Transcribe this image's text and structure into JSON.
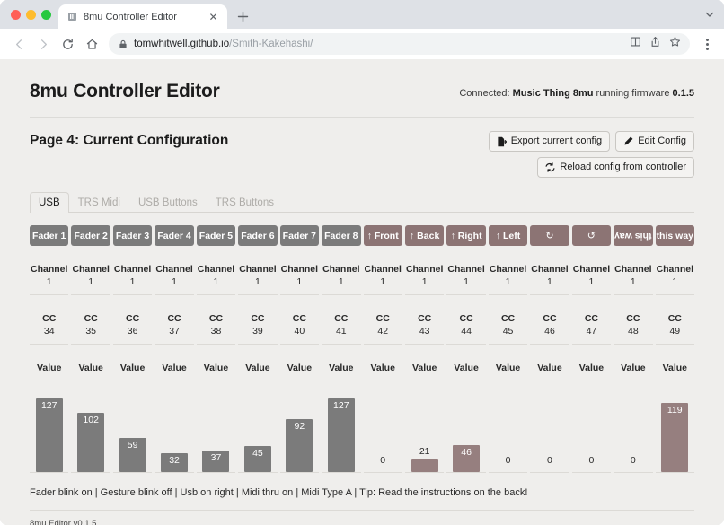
{
  "browser": {
    "tab": {
      "title": "8mu Controller Editor",
      "favicon_icon": "page-icon",
      "close_icon": "close-icon"
    },
    "new_tab_icon": "plus-icon",
    "tabstrip_menu_icon": "chevron-down-icon",
    "nav": {
      "back_icon": "arrow-left-icon",
      "forward_icon": "arrow-right-icon",
      "reload_icon": "reload-icon",
      "home_icon": "home-icon"
    },
    "omnibox": {
      "lock_icon": "lock-icon",
      "url_bold": "tomwhitwell.github.io",
      "url_rest": "/Smith-Kakehashi/",
      "reading_list_icon": "reading-list-icon",
      "share_icon": "share-icon",
      "bookmark_icon": "star-icon"
    },
    "menu_icon": "kebab-menu-icon"
  },
  "app": {
    "title": "8mu Controller Editor",
    "connection": {
      "prefix": "Connected:",
      "device": "Music Thing 8mu",
      "middle": "running firmware",
      "firmware": "0.1.5"
    },
    "page_title": "Page 4: Current Configuration",
    "buttons": {
      "export": {
        "label": "Export current config",
        "icon": "file-export-icon"
      },
      "edit": {
        "label": "Edit Config",
        "icon": "pencil-icon"
      },
      "reload": {
        "label": "Reload config from controller",
        "icon": "refresh-icon"
      }
    },
    "tabs": [
      {
        "label": "USB",
        "active": true
      },
      {
        "label": "TRS Midi",
        "active": false
      },
      {
        "label": "USB Buttons",
        "active": false
      },
      {
        "label": "TRS Buttons",
        "active": false
      }
    ],
    "row_labels": {
      "channel": "Channel",
      "cc": "CC",
      "value": "Value"
    },
    "footnote": "Fader blink on | Gesture blink off | Usb on right | Midi thru on | Midi Type A | Tip: Read the instructions on the back!",
    "version": "8mu Editor v0.1.5"
  },
  "chart_data": {
    "type": "bar",
    "title": "Page 4: Current Configuration",
    "xlabel": "",
    "ylabel": "Value",
    "ylim": [
      0,
      127
    ],
    "grid": false,
    "legend": "none",
    "categories": [
      "Fader 1",
      "Fader 2",
      "Fader 3",
      "Fader 4",
      "Fader 5",
      "Fader 6",
      "Fader 7",
      "Fader 8",
      "↑ Front",
      "↑ Back",
      "↑ Right",
      "↑ Left",
      "↻",
      "↺",
      "this way",
      "this way"
    ],
    "values": [
      127,
      102,
      59,
      32,
      37,
      45,
      92,
      127,
      0,
      21,
      46,
      0,
      0,
      0,
      0,
      119
    ],
    "columns": [
      {
        "label": "Fader 1",
        "kind": "fader",
        "rotated": false,
        "channel": "1",
        "cc": "34",
        "value": 127
      },
      {
        "label": "Fader 2",
        "kind": "fader",
        "rotated": false,
        "channel": "1",
        "cc": "35",
        "value": 102
      },
      {
        "label": "Fader 3",
        "kind": "fader",
        "rotated": false,
        "channel": "1",
        "cc": "36",
        "value": 59
      },
      {
        "label": "Fader 4",
        "kind": "fader",
        "rotated": false,
        "channel": "1",
        "cc": "37",
        "value": 32
      },
      {
        "label": "Fader 5",
        "kind": "fader",
        "rotated": false,
        "channel": "1",
        "cc": "38",
        "value": 37
      },
      {
        "label": "Fader 6",
        "kind": "fader",
        "rotated": false,
        "channel": "1",
        "cc": "39",
        "value": 45
      },
      {
        "label": "Fader 7",
        "kind": "fader",
        "rotated": false,
        "channel": "1",
        "cc": "40",
        "value": 92
      },
      {
        "label": "Fader 8",
        "kind": "fader",
        "rotated": false,
        "channel": "1",
        "cc": "41",
        "value": 127
      },
      {
        "label": "↑ Front",
        "kind": "gesture",
        "rotated": false,
        "channel": "1",
        "cc": "42",
        "value": 0
      },
      {
        "label": "↑ Back",
        "kind": "gesture",
        "rotated": false,
        "channel": "1",
        "cc": "43",
        "value": 21
      },
      {
        "label": "↑ Right",
        "kind": "gesture",
        "rotated": false,
        "channel": "1",
        "cc": "44",
        "value": 46
      },
      {
        "label": "↑ Left",
        "kind": "gesture",
        "rotated": false,
        "channel": "1",
        "cc": "45",
        "value": 0
      },
      {
        "label": "↻",
        "kind": "gesture",
        "rotated": false,
        "channel": "1",
        "cc": "46",
        "value": 0,
        "icon": "rotate-cw-icon"
      },
      {
        "label": "↺",
        "kind": "gesture",
        "rotated": false,
        "channel": "1",
        "cc": "47",
        "value": 0,
        "icon": "rotate-ccw-icon"
      },
      {
        "label": "this way",
        "kind": "gesture",
        "rotated": true,
        "channel": "1",
        "cc": "48",
        "value": 0
      },
      {
        "label": "this way",
        "kind": "gesture",
        "rotated": false,
        "channel": "1",
        "cc": "49",
        "value": 119
      }
    ]
  }
}
